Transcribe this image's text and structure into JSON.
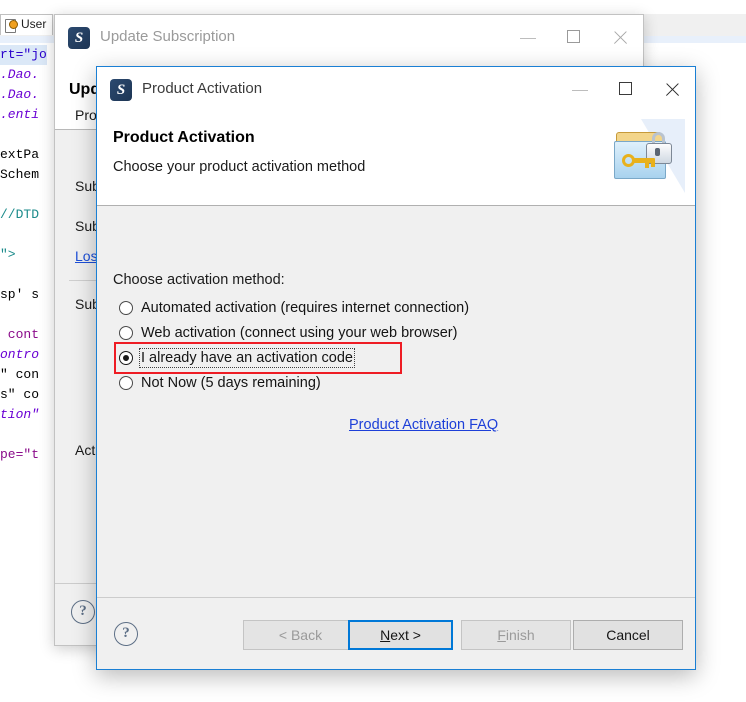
{
  "editor": {
    "tab_label": "User",
    "tab_icon": "bean-file-icon",
    "code_lines": [
      "rt=\"jo",
      ".Dao.",
      ".Dao.",
      ".enti",
      "",
      "extPa",
      "Schem",
      "",
      "//DTD",
      "",
      "\">",
      "",
      "sp' s",
      "",
      " cont",
      "ontro",
      "\" con",
      "s\" co",
      "tion\"",
      "",
      "pe=\"t"
    ]
  },
  "update_subscription": {
    "title": "Update Subscription",
    "app_icon": "app-logo-icon",
    "logo_glyph": "S",
    "minimize_label": "Minimize",
    "maximize_label": "Maximize",
    "close_label": "Close",
    "header_title": "Upda",
    "header_subtitle": "Prod",
    "rows": [
      "Subsc",
      "Subsc",
      "Subsc"
    ],
    "link": "Lost y",
    "activation_label": "Activ",
    "help_label": "?"
  },
  "product_activation": {
    "window_title": "Product Activation",
    "app_icon": "app-logo-icon",
    "logo_glyph": "S",
    "minimize_label": "Minimize",
    "maximize_label": "Maximize",
    "close_label": "Close",
    "header_title": "Product Activation",
    "header_subtitle": "Choose your product activation method",
    "header_icon": "folder-lock-key-icon",
    "group_label": "Choose activation method:",
    "options": [
      {
        "label": "Automated activation (requires internet connection)",
        "selected": false
      },
      {
        "label": "Web activation (connect using your web browser)",
        "selected": false
      },
      {
        "label": "I already have an activation code",
        "selected": true
      },
      {
        "label": "Not Now (5 days remaining)",
        "selected": false
      }
    ],
    "faq_link": "Product Activation FAQ",
    "highlight_color": "#ee1c24",
    "link_color": "#1d3fd8",
    "help_label": "?",
    "buttons": {
      "back": "< Back",
      "next_prefix": "",
      "next_mnemonic": "N",
      "next_suffix": "ext >",
      "finish_mnemonic": "F",
      "finish_suffix": "inish",
      "cancel": "Cancel"
    }
  }
}
